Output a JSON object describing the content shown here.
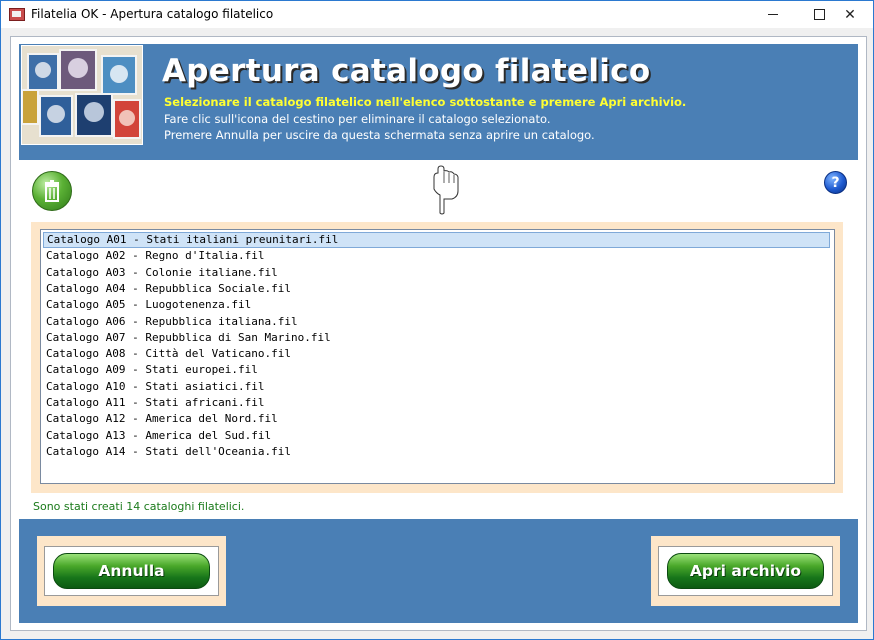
{
  "window": {
    "title": "Filatelia OK - Apertura catalogo filatelico"
  },
  "header": {
    "title": "Apertura catalogo filatelico",
    "line1": "Selezionare il catalogo filatelico nell'elenco sottostante e premere Apri archivio.",
    "line2": "Fare clic sull'icona del cestino per eliminare il catalogo selezionato.",
    "line3": "Premere Annulla per uscire da questa schermata senza aprire un catalogo."
  },
  "toolbar": {
    "trash_icon": "trash-icon",
    "hand_icon": "pointing-hand-icon",
    "help_label": "?"
  },
  "catalogs": [
    "Catalogo A01 - Stati italiani preunitari.fil",
    "Catalogo A02 - Regno d'Italia.fil",
    "Catalogo A03 - Colonie italiane.fil",
    "Catalogo A04 - Repubblica Sociale.fil",
    "Catalogo A05 - Luogotenenza.fil",
    "Catalogo A06 - Repubblica italiana.fil",
    "Catalogo A07 - Repubblica di San Marino.fil",
    "Catalogo A08 - Città del Vaticano.fil",
    "Catalogo A09 - Stati europei.fil",
    "Catalogo A10 - Stati asiatici.fil",
    "Catalogo A11 - Stati africani.fil",
    "Catalogo A12 - America del Nord.fil",
    "Catalogo A13 - America del Sud.fil",
    "Catalogo A14 - Stati dell'Oceania.fil"
  ],
  "selected_index": 0,
  "status": "Sono stati creati 14 cataloghi filatelici.",
  "buttons": {
    "cancel": "Annulla",
    "open": "Apri archivio"
  },
  "colors": {
    "header_bg": "#4a7fb5",
    "header_highlight": "#ffff33",
    "panel_bg": "#fde6c9",
    "button_green": "#17751a",
    "status_green": "#1a7a1a"
  }
}
